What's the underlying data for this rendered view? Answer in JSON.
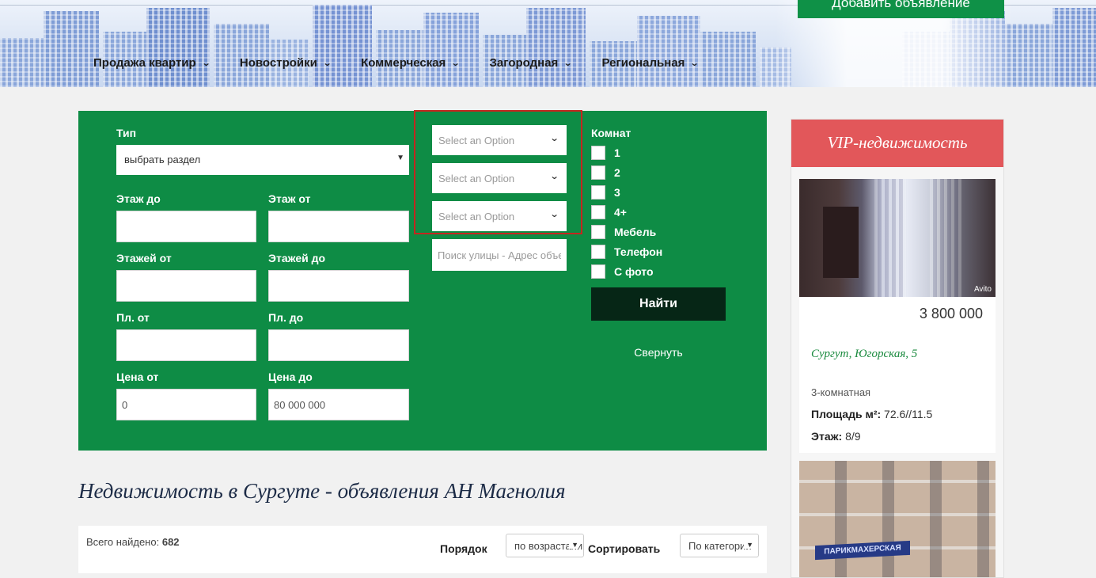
{
  "header": {
    "add_button": "Добавить объявление",
    "nav": [
      {
        "label": "Продажа квартир"
      },
      {
        "label": "Новостройки"
      },
      {
        "label": "Коммерческая"
      },
      {
        "label": "Загородная"
      },
      {
        "label": "Региональная"
      }
    ]
  },
  "search": {
    "type_label": "Тип",
    "type_value": "выбрать раздел",
    "floor_to_label": "Этаж до",
    "floor_from_label": "Этаж от",
    "floors_from_label": "Этажей от",
    "floors_to_label": "Этажей до",
    "area_from_label": "Пл. от",
    "area_to_label": "Пл. до",
    "price_from_label": "Цена от",
    "price_to_label": "Цена до",
    "price_from_value": "0",
    "price_to_value": "80 000 000",
    "option_selects": [
      "Select an Option",
      "Select an Option",
      "Select an Option"
    ],
    "street_placeholder": "Поиск улицы - Адрес объекта",
    "rooms_label": "Комнат",
    "checkboxes": [
      "1",
      "2",
      "3",
      "4+",
      "Мебель",
      "Телефон",
      "С фото"
    ],
    "find_button": "Найти",
    "collapse_link": "Свернуть"
  },
  "page_title": "Недвижимость в Сургуте - объявления АН Магнолия",
  "results": {
    "total_label": "Всего найдено:",
    "total_value": "682",
    "order_label": "Порядок",
    "order_value": "по возрастанию",
    "sort_label": "Сортировать",
    "sort_value": "По категории"
  },
  "vip": {
    "title": "VIP-недвижимость",
    "card": {
      "watermark": "Avito",
      "price": "3 800 000",
      "address": "Сургут, Югорская, 5",
      "rooms": "3-комнатная",
      "area_label": "Площадь м²:",
      "area_value": "72.6//11.5",
      "floor_label": "Этаж:",
      "floor_value": "8/9"
    },
    "card2_sign": "ПАРИКМАХЕРСКАЯ"
  },
  "colors": {
    "panel_green": "#0e8c45",
    "find_button_bg": "#062616",
    "vip_header": "#e2575a",
    "highlight_border": "#c4261f",
    "address_green": "#1a8a3e"
  }
}
